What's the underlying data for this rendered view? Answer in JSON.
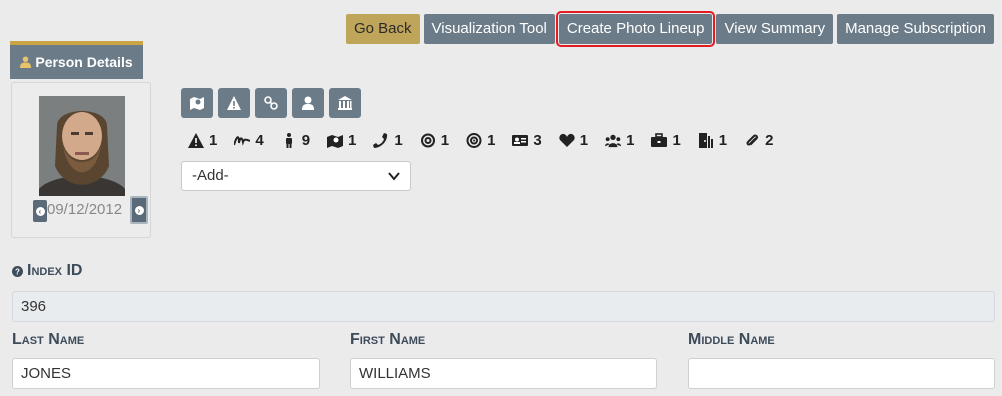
{
  "top_buttons": {
    "go_back": "Go Back",
    "visualization_tool": "Visualization Tool",
    "create_photo_lineup": "Create Photo Lineup",
    "view_summary": "View Summary",
    "manage_subscription": "Manage Subscription"
  },
  "tab": {
    "label": "Person Details",
    "icon": "person-icon"
  },
  "photo": {
    "date": "09/12/2012"
  },
  "action_icons": [
    "map-marker-icon",
    "warning-icon",
    "link-icon",
    "person-icon",
    "building-icon"
  ],
  "counts": [
    {
      "icon": "warning-icon",
      "value": "1"
    },
    {
      "icon": "signature-icon",
      "value": "4"
    },
    {
      "icon": "person-standing-icon",
      "value": "9"
    },
    {
      "icon": "map-icon",
      "value": "1"
    },
    {
      "icon": "phone-icon",
      "value": "1"
    },
    {
      "icon": "at-icon",
      "value": "1"
    },
    {
      "icon": "target-icon",
      "value": "1"
    },
    {
      "icon": "id-card-icon",
      "value": "3"
    },
    {
      "icon": "heart-icon",
      "value": "1"
    },
    {
      "icon": "users-icon",
      "value": "1"
    },
    {
      "icon": "briefcase-icon",
      "value": "1"
    },
    {
      "icon": "door-icon",
      "value": "1"
    },
    {
      "icon": "paperclip-icon",
      "value": "2"
    }
  ],
  "add_select": {
    "value": "-Add-"
  },
  "fields": {
    "index_id": {
      "label": "Index ID",
      "value": "396"
    },
    "last_name": {
      "label": "Last Name",
      "value": "JONES"
    },
    "first_name": {
      "label": "First Name",
      "value": "WILLIAMS"
    },
    "middle_name": {
      "label": "Middle Name",
      "value": ""
    }
  },
  "colors": {
    "button": "#6b7b88",
    "gold": "#bfa55a",
    "highlight": "#e31b23"
  }
}
